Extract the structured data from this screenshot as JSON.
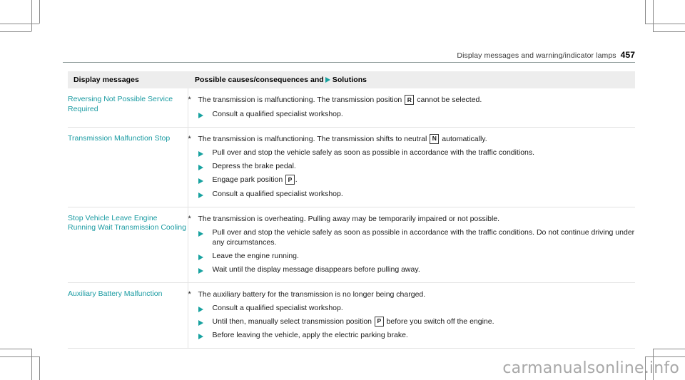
{
  "page": {
    "running_head": "Display messages and warning/indicator lamps",
    "page_number": "457",
    "watermark": "carmanualsonline.info",
    "accent_color": "#1a9ba2",
    "header_bg": "#ededed"
  },
  "table": {
    "headers": {
      "left": "Display messages",
      "right_before_icon": "Possible causes/consequences and",
      "right_after_icon": "Solutions",
      "icon": "solution-triangle-icon"
    },
    "rows": [
      {
        "message": "Reversing Not Possible Service Required",
        "cause_marker": "*",
        "cause_parts": [
          {
            "type": "text",
            "value": "The transmission is malfunctioning. The transmission position "
          },
          {
            "type": "badge",
            "value": "R"
          },
          {
            "type": "text",
            "value": " cannot be selected."
          }
        ],
        "solutions": [
          [
            {
              "type": "text",
              "value": "Consult a qualified specialist workshop."
            }
          ]
        ]
      },
      {
        "message": "Transmission Malfunction Stop",
        "cause_marker": "*",
        "cause_parts": [
          {
            "type": "text",
            "value": "The transmission is malfunctioning. The transmission shifts to neutral "
          },
          {
            "type": "badge",
            "value": "N"
          },
          {
            "type": "text",
            "value": " automatically."
          }
        ],
        "solutions": [
          [
            {
              "type": "text",
              "value": "Pull over and stop the vehicle safely as soon as possible in accordance with the traffic conditions."
            }
          ],
          [
            {
              "type": "text",
              "value": "Depress the brake pedal."
            }
          ],
          [
            {
              "type": "text",
              "value": "Engage park position "
            },
            {
              "type": "badge",
              "value": "P"
            },
            {
              "type": "text",
              "value": "."
            }
          ],
          [
            {
              "type": "text",
              "value": "Consult a qualified specialist workshop."
            }
          ]
        ]
      },
      {
        "message": "Stop Vehicle Leave Engine Running Wait Transmission Cooling",
        "cause_marker": "*",
        "cause_parts": [
          {
            "type": "text",
            "value": "The transmission is overheating. Pulling away may be temporarily impaired or not possible."
          }
        ],
        "solutions": [
          [
            {
              "type": "text",
              "value": "Pull over and stop the vehicle safely as soon as possible in accordance with the traffic conditions. Do not continue driving under any circumstances."
            }
          ],
          [
            {
              "type": "text",
              "value": "Leave the engine running."
            }
          ],
          [
            {
              "type": "text",
              "value": "Wait until the display message disappears before pulling away."
            }
          ]
        ]
      },
      {
        "message": "Auxiliary Battery Malfunction",
        "cause_marker": "*",
        "cause_parts": [
          {
            "type": "text",
            "value": "The auxiliary battery for the transmission is no longer being charged."
          }
        ],
        "solutions": [
          [
            {
              "type": "text",
              "value": "Consult a qualified specialist workshop."
            }
          ],
          [
            {
              "type": "text",
              "value": "Until then, manually select transmission position "
            },
            {
              "type": "badge",
              "value": "P"
            },
            {
              "type": "text",
              "value": " before you switch off the engine."
            }
          ],
          [
            {
              "type": "text",
              "value": "Before leaving the vehicle, apply the electric parking brake."
            }
          ]
        ]
      }
    ]
  }
}
